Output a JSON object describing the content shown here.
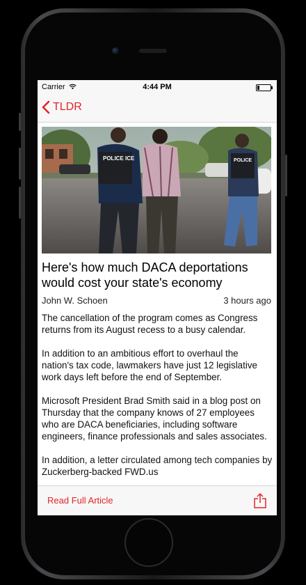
{
  "status_bar": {
    "carrier": "Carrier",
    "time": "4:44 PM",
    "icons": [
      "wifi-icon",
      "battery-icon"
    ]
  },
  "nav": {
    "back_label": "TLDR",
    "back_icon": "chevron-left-icon"
  },
  "article": {
    "headline": "Here's how much DACA deportations would cost your state's economy",
    "author": "John W. Schoen",
    "time_ago": "3 hours ago",
    "image_badges": [
      "POLICE ICE",
      "POLICE"
    ],
    "paragraphs": [
      "The cancellation of the program comes as Congress returns from its August recess to a busy calendar.",
      "In addition to an ambitious effort to overhaul the nation's tax code, lawmakers have just 12 legislative work days left before the end of September.",
      "Microsoft President Brad Smith said in a blog post on Thursday that the company knows of 27 employees who are DACA beneficiaries, including software engineers, finance professionals and sales associates.",
      "In addition, a letter circulated among tech companies by Zuckerberg-backed FWD.us"
    ]
  },
  "toolbar": {
    "read_full_label": "Read Full Article",
    "share_icon": "share-icon"
  },
  "colors": {
    "accent": "#e3242b",
    "bar_background": "#f7f7f7",
    "device_frame": "#1a1a1c"
  }
}
